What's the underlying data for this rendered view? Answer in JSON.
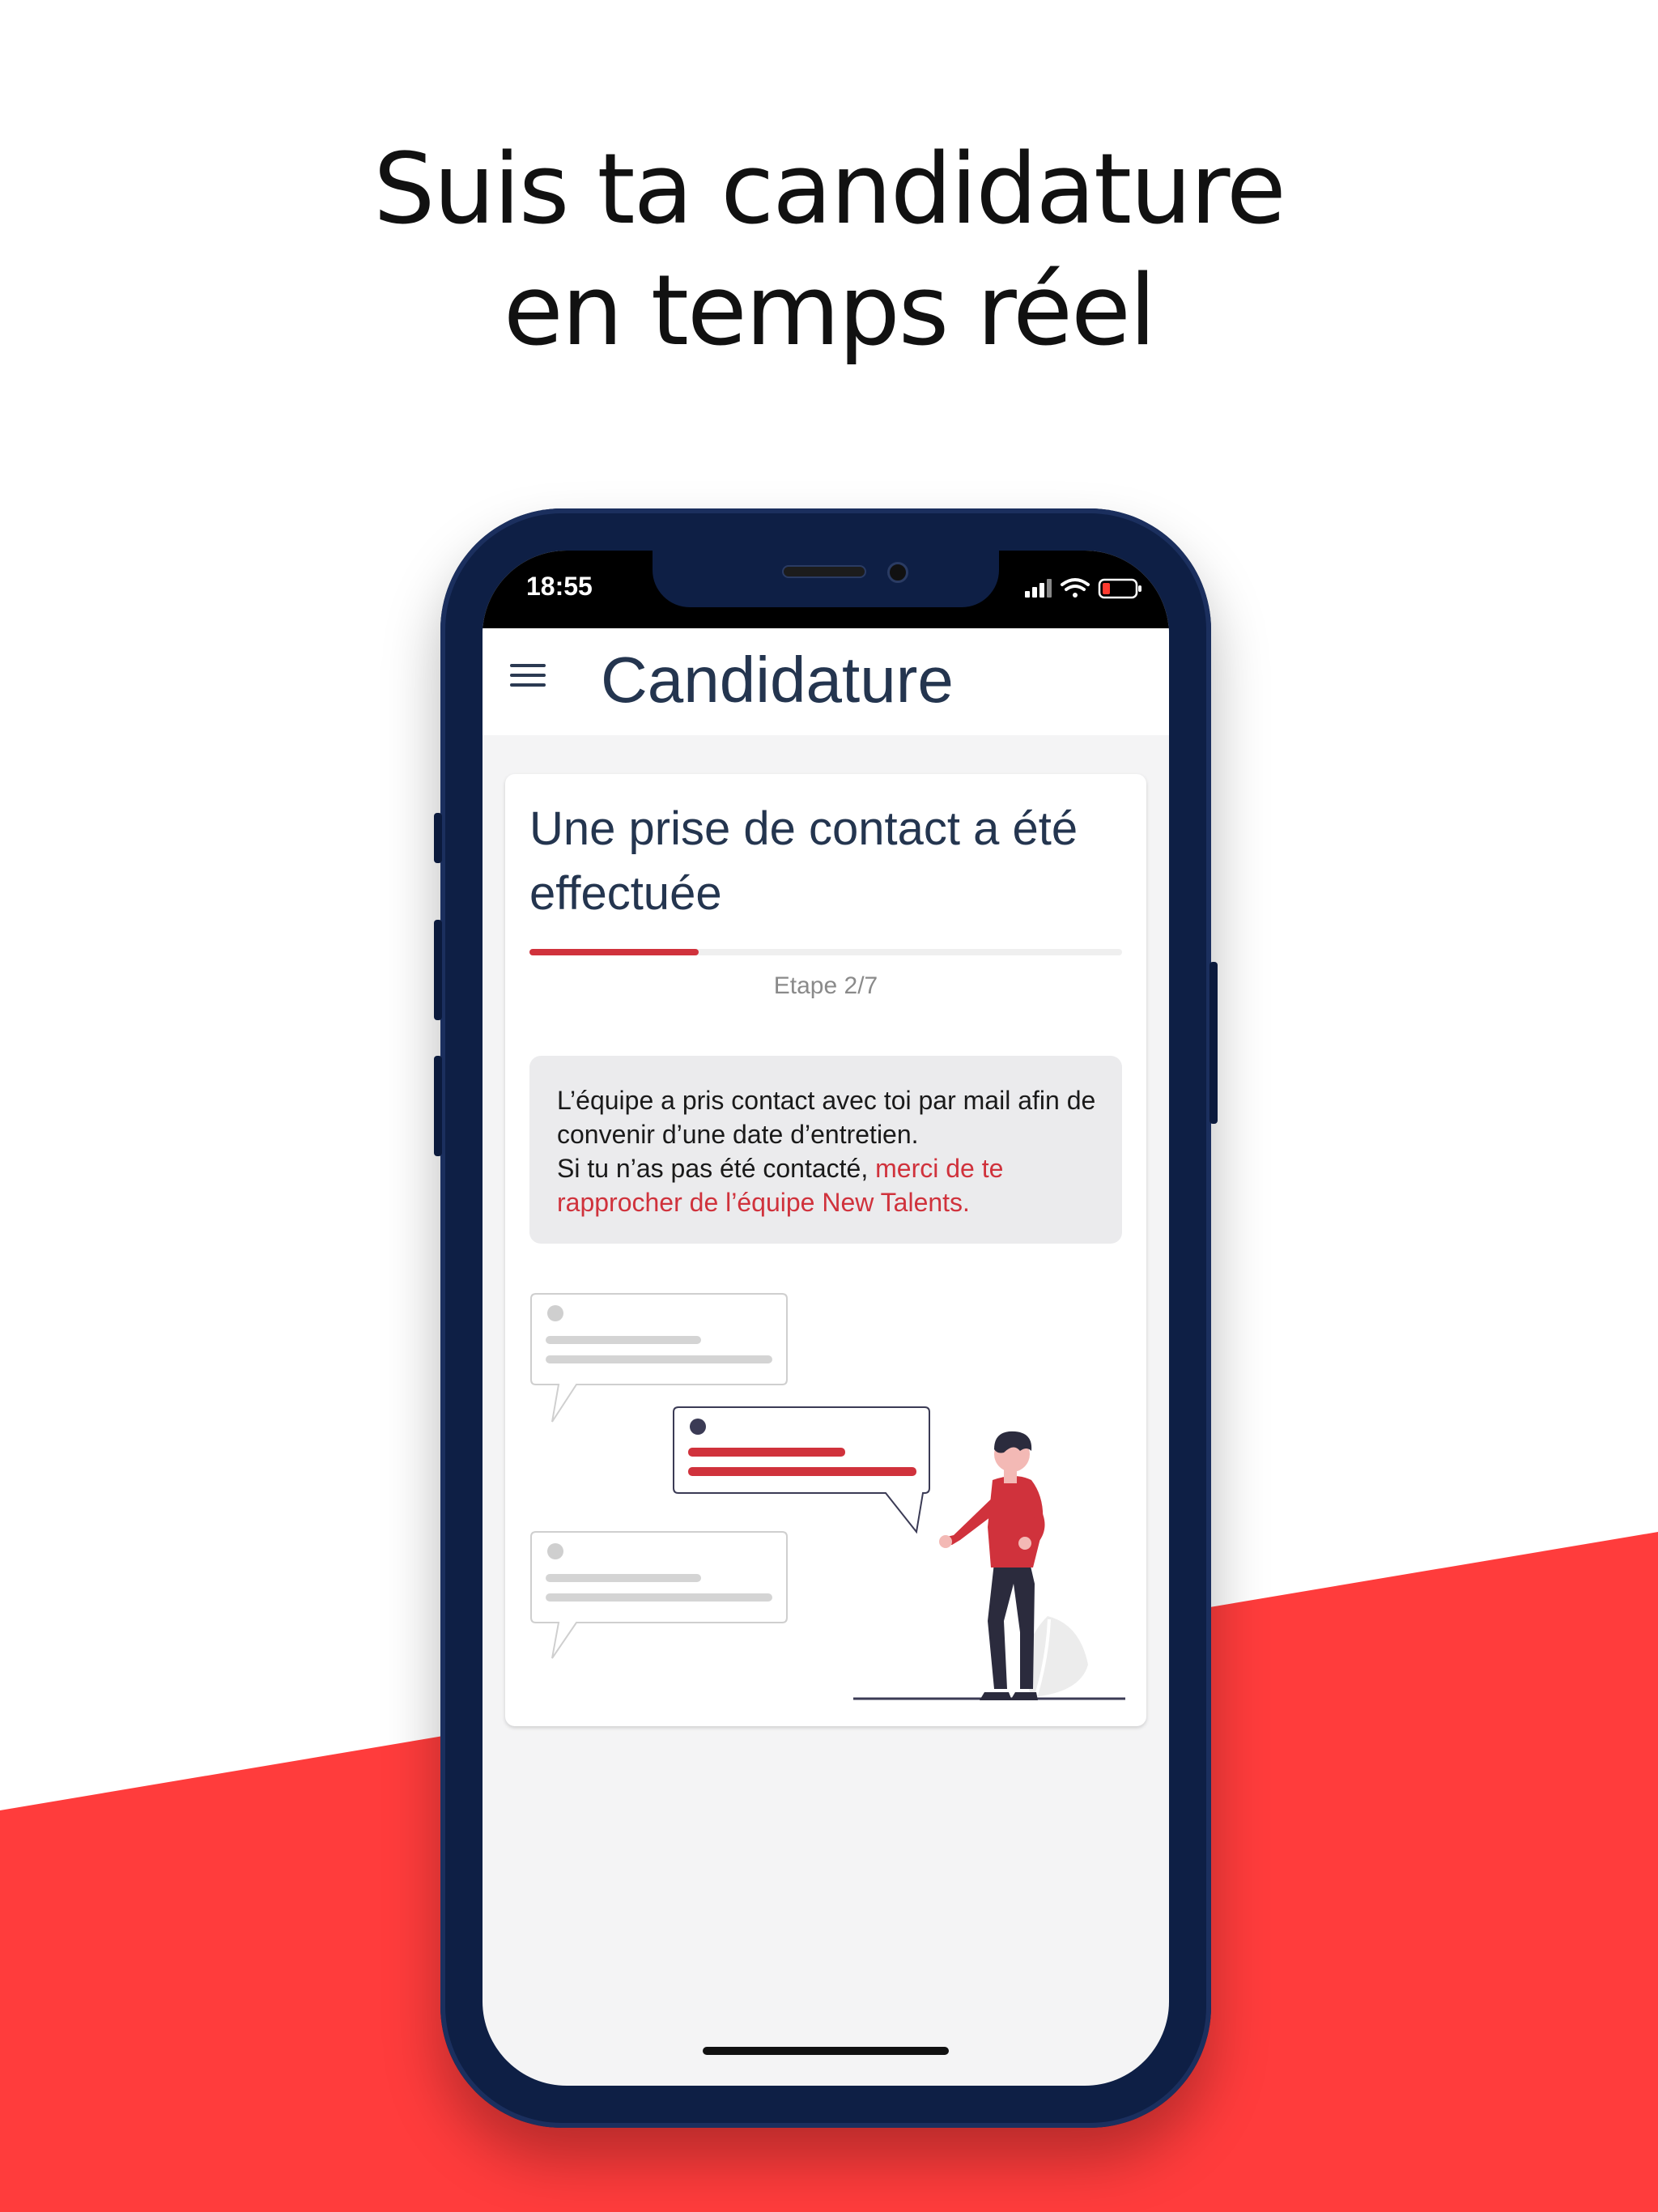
{
  "headline": {
    "line1": "Suis ta candidature",
    "line2": "en temps réel"
  },
  "colors": {
    "accent_red": "#ff3c3c",
    "brand_red": "#d0323c",
    "navy": "#24354f",
    "phone_frame": "#0e1f45"
  },
  "status_bar": {
    "time": "18:55",
    "icons": [
      "signal-icon",
      "wifi-icon",
      "battery-low-icon"
    ]
  },
  "app": {
    "menu_icon": "hamburger-menu-icon",
    "title": "Candidature"
  },
  "card": {
    "title": "Une prise de contact a été effectuée",
    "progress_fraction": 0.2857,
    "step_label": "Etape 2/7",
    "info": {
      "line1": "L’équipe a pris contact avec toi par mail afin de convenir d’une date d’entretien.",
      "line2_prefix": "Si tu n’as pas été contacté, ",
      "line2_link": "merci de te rapprocher de l’équipe New Talents."
    },
    "illustration": "person-with-chat-bubbles-illustration"
  }
}
